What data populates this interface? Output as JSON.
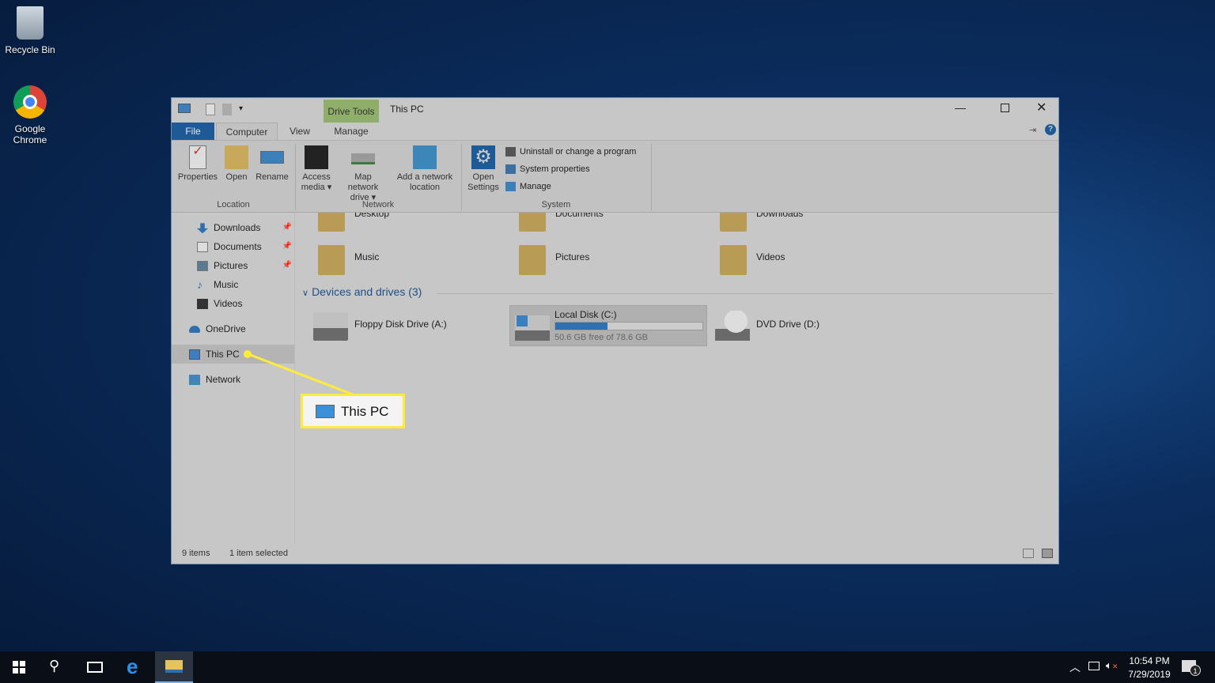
{
  "desktop": {
    "icons": [
      {
        "label": "Recycle Bin"
      },
      {
        "label": "Google Chrome"
      }
    ]
  },
  "window": {
    "title": "This PC",
    "context_tab_group": "Drive Tools",
    "tabs": [
      {
        "label": "File"
      },
      {
        "label": "Computer"
      },
      {
        "label": "View"
      },
      {
        "label": "Manage"
      }
    ],
    "ribbon": {
      "location": {
        "label": "Location",
        "buttons": [
          {
            "label": "Properties"
          },
          {
            "label": "Open"
          },
          {
            "label": "Rename"
          }
        ]
      },
      "network": {
        "label": "Network",
        "buttons": [
          {
            "label": "Access media ▾"
          },
          {
            "label": "Map network drive ▾"
          },
          {
            "label": "Add a network location"
          }
        ]
      },
      "system": {
        "label": "System",
        "open_settings": "Open Settings",
        "items": [
          {
            "label": "Uninstall or change a program"
          },
          {
            "label": "System properties"
          },
          {
            "label": "Manage"
          }
        ]
      }
    },
    "nav": [
      {
        "label": "Downloads",
        "pinned": true
      },
      {
        "label": "Documents",
        "pinned": true
      },
      {
        "label": "Pictures",
        "pinned": true
      },
      {
        "label": "Music"
      },
      {
        "label": "Videos"
      },
      {
        "label": "OneDrive"
      },
      {
        "label": "This PC",
        "selected": true
      },
      {
        "label": "Network"
      }
    ],
    "folders": [
      {
        "label": "Desktop"
      },
      {
        "label": "Documents"
      },
      {
        "label": "Downloads"
      },
      {
        "label": "Music"
      },
      {
        "label": "Pictures"
      },
      {
        "label": "Videos"
      }
    ],
    "devices_header": "Devices and drives (3)",
    "drives": [
      {
        "label": "Floppy Disk Drive (A:)"
      },
      {
        "label": "Local Disk (C:)",
        "free_text": "50.6 GB free of 78.6 GB",
        "used_percent": 35.6,
        "selected": true
      },
      {
        "label": "DVD Drive (D:)"
      }
    ],
    "status": {
      "items": "9 items",
      "selected": "1 item selected"
    }
  },
  "callout": {
    "label": "This PC",
    "color": "#ffeb3b"
  },
  "taskbar": {
    "time": "10:54 PM",
    "date": "7/29/2019",
    "notifications": "1"
  }
}
